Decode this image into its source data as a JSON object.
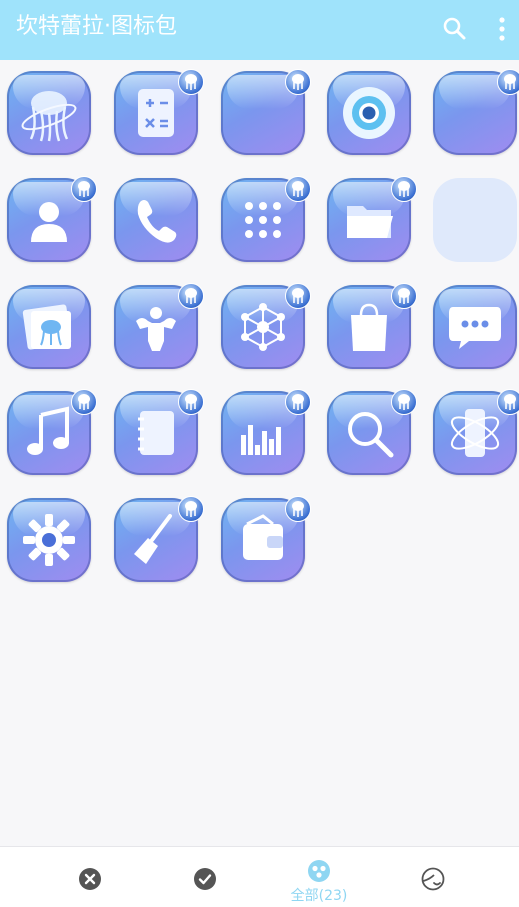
{
  "appbar": {
    "title": "坎特蕾拉·图标包",
    "search_icon": "search-icon",
    "menu_icon": "more-vert-icon",
    "background": "#9fe3fb"
  },
  "icons": [
    {
      "name": "jellyfish-app",
      "glyph": "jellyfish"
    },
    {
      "name": "calculator",
      "glyph": "calculator"
    },
    {
      "name": "blank",
      "glyph": "blank"
    },
    {
      "name": "camera",
      "glyph": "eye"
    },
    {
      "name": "blank",
      "glyph": "blank"
    },
    {
      "name": "contacts",
      "glyph": "person"
    },
    {
      "name": "phone",
      "glyph": "phone"
    },
    {
      "name": "app-drawer",
      "glyph": "dots"
    },
    {
      "name": "files",
      "glyph": "folder"
    },
    {
      "name": "empty",
      "glyph": "ghost"
    },
    {
      "name": "gallery",
      "glyph": "gallery"
    },
    {
      "name": "fitness",
      "glyph": "muscle"
    },
    {
      "name": "network",
      "glyph": "hexnet"
    },
    {
      "name": "store",
      "glyph": "bag"
    },
    {
      "name": "messages",
      "glyph": "chat"
    },
    {
      "name": "music",
      "glyph": "music"
    },
    {
      "name": "notes",
      "glyph": "notebook"
    },
    {
      "name": "equalizer",
      "glyph": "equalizer"
    },
    {
      "name": "search",
      "glyph": "magnifier"
    },
    {
      "name": "phone-manager",
      "glyph": "phoneorbit"
    },
    {
      "name": "settings",
      "glyph": "gear"
    },
    {
      "name": "cleaner",
      "glyph": "broom"
    },
    {
      "name": "wallet",
      "glyph": "wallet"
    }
  ],
  "bottom_nav": {
    "items": [
      {
        "icon": "close-circle-icon",
        "label": ""
      },
      {
        "icon": "check-circle-icon",
        "label": ""
      },
      {
        "icon": "all-icon",
        "label": "全部(23)"
      },
      {
        "icon": "moon-face-icon",
        "label": ""
      }
    ],
    "active_color": "#8fd6f2",
    "inactive_color": "#555555"
  }
}
